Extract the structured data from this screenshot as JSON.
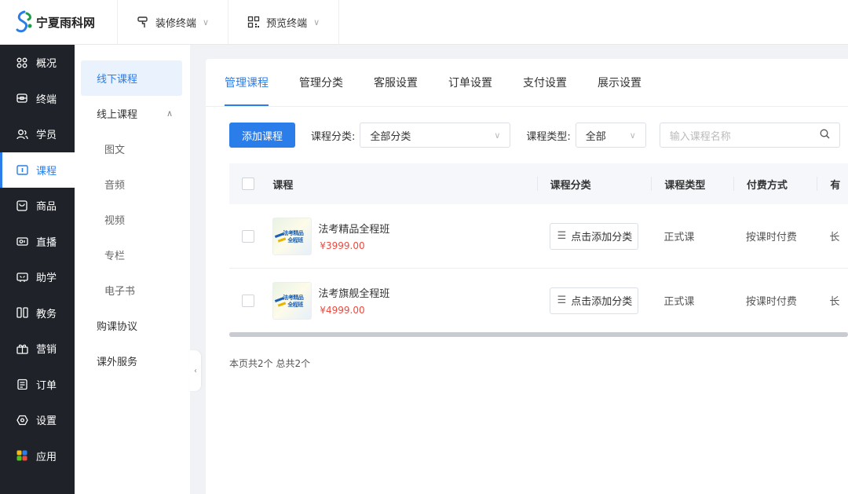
{
  "brand": {
    "name": "宁夏雨科网"
  },
  "topbar": {
    "items": [
      {
        "label": "装修终端",
        "icon": "paint-roller-icon"
      },
      {
        "label": "预览终端",
        "icon": "qr-grid-icon"
      }
    ]
  },
  "sidebar": {
    "items": [
      {
        "label": "概况",
        "icon": "dashboard-icon"
      },
      {
        "label": "终端",
        "icon": "terminal-icon"
      },
      {
        "label": "学员",
        "icon": "users-icon"
      },
      {
        "label": "课程",
        "icon": "course-icon",
        "active": true
      },
      {
        "label": "商品",
        "icon": "goods-icon"
      },
      {
        "label": "直播",
        "icon": "live-icon"
      },
      {
        "label": "助学",
        "icon": "study-icon"
      },
      {
        "label": "教务",
        "icon": "edu-icon"
      },
      {
        "label": "营销",
        "icon": "marketing-icon"
      },
      {
        "label": "订单",
        "icon": "order-icon"
      },
      {
        "label": "设置",
        "icon": "settings-icon"
      },
      {
        "label": "应用",
        "icon": "apps-icon"
      }
    ]
  },
  "subnav": {
    "items": [
      {
        "label": "线下课程",
        "active": true
      },
      {
        "label": "线上课程",
        "expandable": true
      },
      {
        "label": "图文",
        "child": true
      },
      {
        "label": "音频",
        "child": true
      },
      {
        "label": "视频",
        "child": true
      },
      {
        "label": "专栏",
        "child": true
      },
      {
        "label": "电子书",
        "child": true
      },
      {
        "label": "购课协议"
      },
      {
        "label": "课外服务"
      }
    ]
  },
  "tabs": [
    "管理课程",
    "管理分类",
    "客服设置",
    "订单设置",
    "支付设置",
    "展示设置"
  ],
  "filters": {
    "add_button": "添加课程",
    "category_label": "课程分类:",
    "category_value": "全部分类",
    "type_label": "课程类型:",
    "type_value": "全部",
    "search_placeholder": "输入课程名称"
  },
  "table": {
    "headers": {
      "course": "课程",
      "category": "课程分类",
      "type": "课程类型",
      "pay": "付费方式",
      "valid": "有"
    },
    "rows": [
      {
        "name": "法考精品全程班",
        "price": "¥3999.00",
        "category_button": "点击添加分类",
        "type": "正式课",
        "pay": "按课时付费",
        "valid": "长"
      },
      {
        "name": "法考旗舰全程班",
        "price": "¥4999.00",
        "category_button": "点击添加分类",
        "type": "正式课",
        "pay": "按课时付费",
        "valid": "长"
      }
    ]
  },
  "thumbnail_text": {
    "line1": "法考精品",
    "line2": "全程班"
  },
  "pager": {
    "summary": "本页共2个 总共2个"
  },
  "colors": {
    "accent": "#2b7de9",
    "price": "#f0483e",
    "sidebar_bg": "#1f2329"
  }
}
